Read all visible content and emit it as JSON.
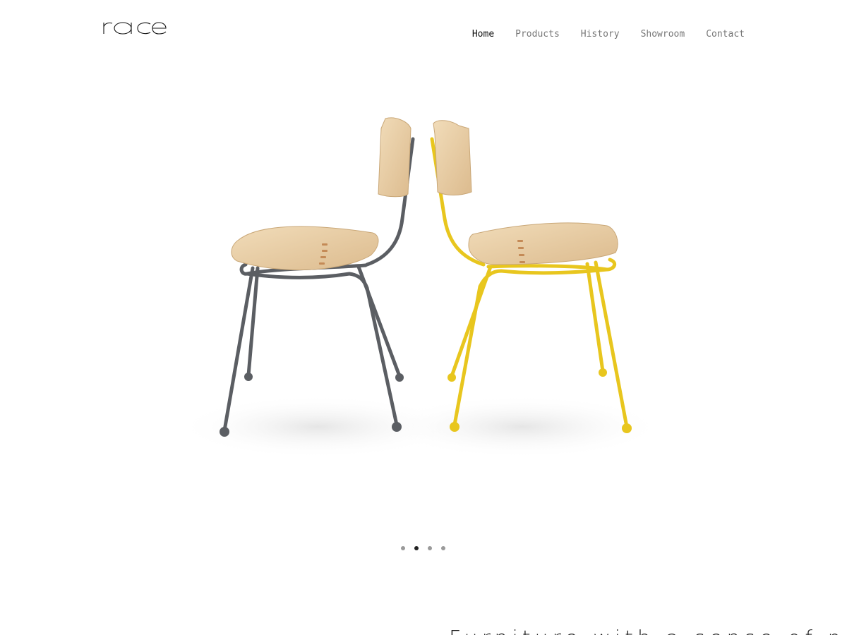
{
  "brand": {
    "logo_text": "race"
  },
  "nav": {
    "items": [
      {
        "label": "Home",
        "active": true
      },
      {
        "label": "Products",
        "active": false
      },
      {
        "label": "History",
        "active": false
      },
      {
        "label": "Showroom",
        "active": false
      },
      {
        "label": "Contact",
        "active": false
      }
    ]
  },
  "hero": {
    "slides_total": 4,
    "active_slide": 2,
    "chairs": [
      {
        "frame_color": "#5b5e63",
        "wood_color": "#ecd2ab"
      },
      {
        "frame_color": "#e8c61e",
        "wood_color": "#ecd2ab"
      }
    ]
  },
  "colors": {
    "nav_active": "#111111",
    "nav_inactive": "#777777",
    "dot_inactive": "#9a9a9a",
    "dot_active": "#222222"
  },
  "section": {
    "heading": "Furniture with a sense of purpose"
  }
}
